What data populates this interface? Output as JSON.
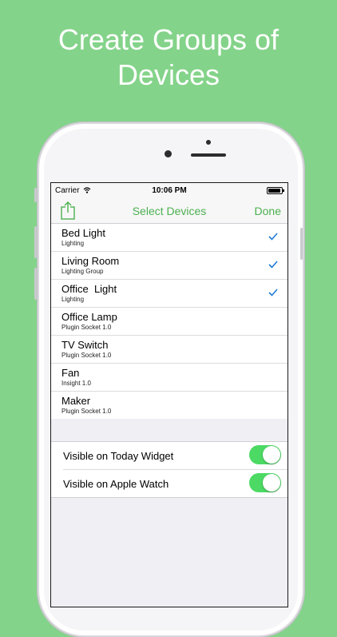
{
  "headline": {
    "line1": "Create Groups of",
    "line2": "Devices"
  },
  "status_bar": {
    "carrier": "Carrier",
    "time": "10:06 PM"
  },
  "nav": {
    "title": "Select Devices",
    "done_label": "Done"
  },
  "devices": [
    {
      "name": "Bed Light",
      "type": "Lighting",
      "checked": true
    },
    {
      "name": "Living Room",
      "type": "Lighting Group",
      "checked": true
    },
    {
      "name": "Office  Light",
      "type": "Lighting",
      "checked": true
    },
    {
      "name": "Office Lamp",
      "type": "Plugin Socket 1.0",
      "checked": false
    },
    {
      "name": "TV Switch",
      "type": "Plugin Socket 1.0",
      "checked": false
    },
    {
      "name": "Fan",
      "type": "Insight 1.0",
      "checked": false
    },
    {
      "name": "Maker",
      "type": "Plugin Socket 1.0",
      "checked": false
    }
  ],
  "settings": [
    {
      "label": "Visible on Today Widget",
      "on": true
    },
    {
      "label": "Visible on Apple Watch",
      "on": true
    }
  ],
  "colors": {
    "background": "#84d38a",
    "accent": "#4cb050",
    "toggle_on": "#4cd964"
  },
  "icons": {
    "share": "share-icon",
    "check": "checkmark-icon",
    "wifi": "wifi-icon",
    "battery": "battery-icon"
  }
}
